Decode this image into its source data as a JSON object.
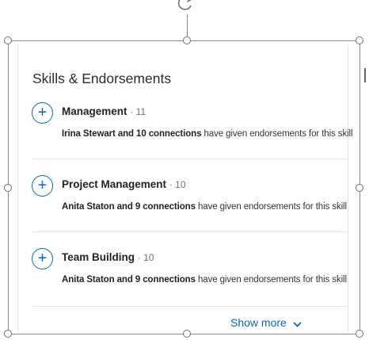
{
  "card": {
    "title": "Skills & Endorsements",
    "skills": [
      {
        "name": "Management",
        "count": "· 11",
        "endorsers": "Irina Stewart and 10 connections",
        "suffix": "have given endorsements for this skill",
        "icon": "plus-icon"
      },
      {
        "name": "Project Management",
        "count": "· 10",
        "endorsers": "Anita Staton and 9 connections",
        "suffix": "have given endorsements for this skill",
        "icon": "plus-icon"
      },
      {
        "name": "Team Building",
        "count": "· 10",
        "endorsers": "Anita Staton and 9 connections",
        "suffix": "have given endorsements for this skill",
        "icon": "plus-icon"
      }
    ],
    "show_more": "Show more",
    "show_more_icon": "chevron-down-icon"
  },
  "colors": {
    "accent": "#0a66c2",
    "text": "#222222",
    "divider": "#e3e3e3",
    "selection_frame": "#8a8a8a"
  },
  "icons": {
    "rotate": "rotate-handle-icon",
    "resize": "resize-handle-icon"
  }
}
